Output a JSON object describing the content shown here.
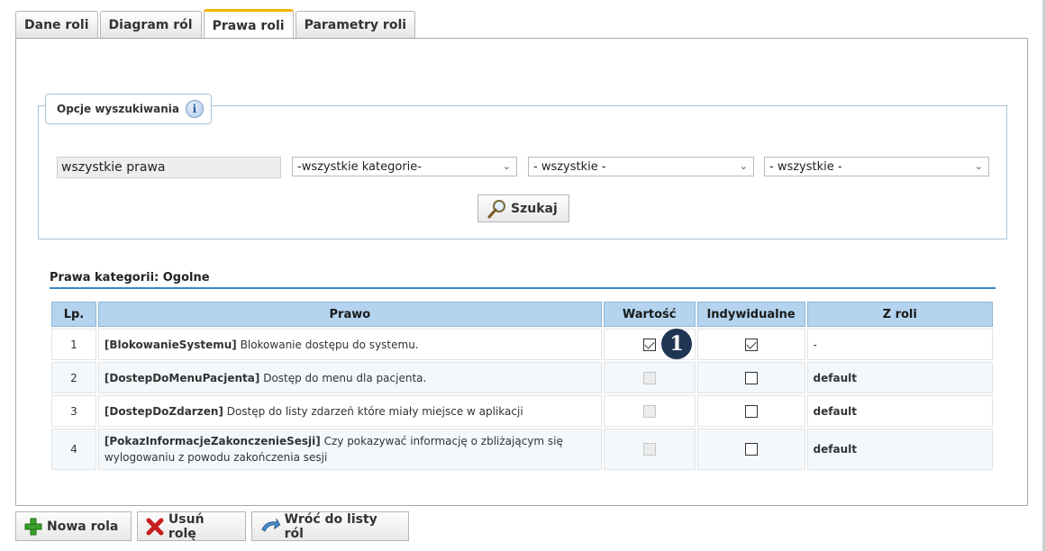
{
  "tabs": [
    {
      "label": "Dane roli",
      "active": false
    },
    {
      "label": "Diagram ról",
      "active": false
    },
    {
      "label": "Prawa roli",
      "active": true
    },
    {
      "label": "Parametry roli",
      "active": false
    }
  ],
  "search": {
    "legend": "Opcje wyszukiwania",
    "info_icon": "info-icon",
    "text_value": "wszystkie prawa",
    "category_select": "-wszystkie kategorie-",
    "select2": "- wszystkie -",
    "select3": "- wszystkie -",
    "search_button": "Szukaj"
  },
  "section_title": "Prawa kategorii: Ogolne",
  "table": {
    "headers": [
      "Lp.",
      "Prawo",
      "Wartość",
      "Indywidualne",
      "Z roli"
    ],
    "rows": [
      {
        "lp": "1",
        "code": "[BlokowanieSystemu]",
        "desc": "Blokowanie dostępu do systemu.",
        "value_checked": true,
        "value_enabled": true,
        "individual_checked": true,
        "from_role": "-"
      },
      {
        "lp": "2",
        "code": "[DostepDoMenuPacjenta]",
        "desc": "Dostęp do menu dla pacjenta.",
        "value_checked": false,
        "value_enabled": false,
        "individual_checked": false,
        "from_role": "default"
      },
      {
        "lp": "3",
        "code": "[DostepDoZdarzen]",
        "desc": "Dostęp do listy zdarzeń które miały miejsce w aplikacji",
        "value_checked": false,
        "value_enabled": false,
        "individual_checked": false,
        "from_role": "default"
      },
      {
        "lp": "4",
        "code": "[PokazInformacjeZakonczenieSesji]",
        "desc": "Czy pokazywać informację o zbliżającym się wylogowaniu z powodu zakończenia sesji",
        "value_checked": false,
        "value_enabled": false,
        "individual_checked": false,
        "from_role": "default"
      }
    ]
  },
  "marker_label": "1",
  "footer": {
    "new_role": "Nowa rola",
    "delete_role": "Usuń rolę",
    "back_to_list": "Wróć do listy ról"
  },
  "colors": {
    "accent_tab": "#f0b400",
    "header_bg": "#b3d3ee",
    "rule": "#3a87c8"
  }
}
